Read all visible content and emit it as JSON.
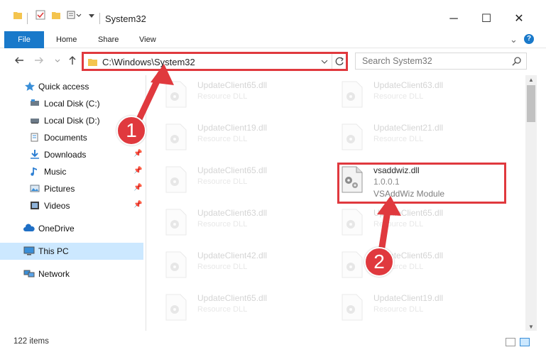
{
  "window": {
    "title": "System32",
    "minimize_glyph": "─",
    "maximize_glyph": "☐",
    "close_glyph": "✕"
  },
  "ribbon": {
    "tabs": [
      "File",
      "Home",
      "Share",
      "View"
    ],
    "expand_glyph": "⌄",
    "help_glyph": "?"
  },
  "address": {
    "path": "C:\\Windows\\System32",
    "search_placeholder": "Search System32"
  },
  "sidebar": {
    "items": [
      {
        "label": "Quick access",
        "icon": "star-icon"
      },
      {
        "label": "Local Disk (C:)",
        "icon": "drive-icon"
      },
      {
        "label": "Local Disk (D:)",
        "icon": "drive-icon"
      },
      {
        "label": "Documents",
        "icon": "documents-icon"
      },
      {
        "label": "Downloads",
        "icon": "download-icon",
        "pinned": true
      },
      {
        "label": "Music",
        "icon": "music-icon",
        "pinned": true
      },
      {
        "label": "Pictures",
        "icon": "pictures-icon",
        "pinned": true
      },
      {
        "label": "Videos",
        "icon": "videos-icon",
        "pinned": true
      },
      {
        "label": "OneDrive",
        "icon": "cloud-icon"
      },
      {
        "label": "This PC",
        "icon": "computer-icon",
        "selected": true
      },
      {
        "label": "Network",
        "icon": "network-icon"
      }
    ]
  },
  "files": {
    "left": [
      {
        "name": "UpdateClient65.dll",
        "type": "Resource DLL"
      },
      {
        "name": "UpdateClient19.dll",
        "type": "Resource DLL"
      },
      {
        "name": "UpdateClient65.dll",
        "type": "Resource DLL"
      },
      {
        "name": "UpdateClient63.dll",
        "type": "Resource DLL"
      },
      {
        "name": "UpdateClient42.dll",
        "type": "Resource DLL"
      },
      {
        "name": "UpdateClient65.dll",
        "type": "Resource DLL"
      }
    ],
    "right": [
      {
        "name": "UpdateClient63.dll",
        "type": "Resource DLL"
      },
      {
        "name": "UpdateClient21.dll",
        "type": "Resource DLL"
      },
      {
        "name": "vsaddwiz.dll",
        "version": "1.0.0.1",
        "type": "VSAddWiz Module",
        "highlighted": true
      },
      {
        "name": "UpdateClient65.dll",
        "type": "Resource DLL"
      },
      {
        "name": "UpdateClient65.dll",
        "type": "Resource DLL"
      },
      {
        "name": "UpdateClient19.dll",
        "type": "Resource DLL"
      }
    ]
  },
  "status": {
    "item_count": "122 items"
  },
  "callouts": [
    "1",
    "2"
  ],
  "colors": {
    "accent": "#1979ca",
    "highlight_red": "#e0393e",
    "selection": "#cce8ff"
  }
}
